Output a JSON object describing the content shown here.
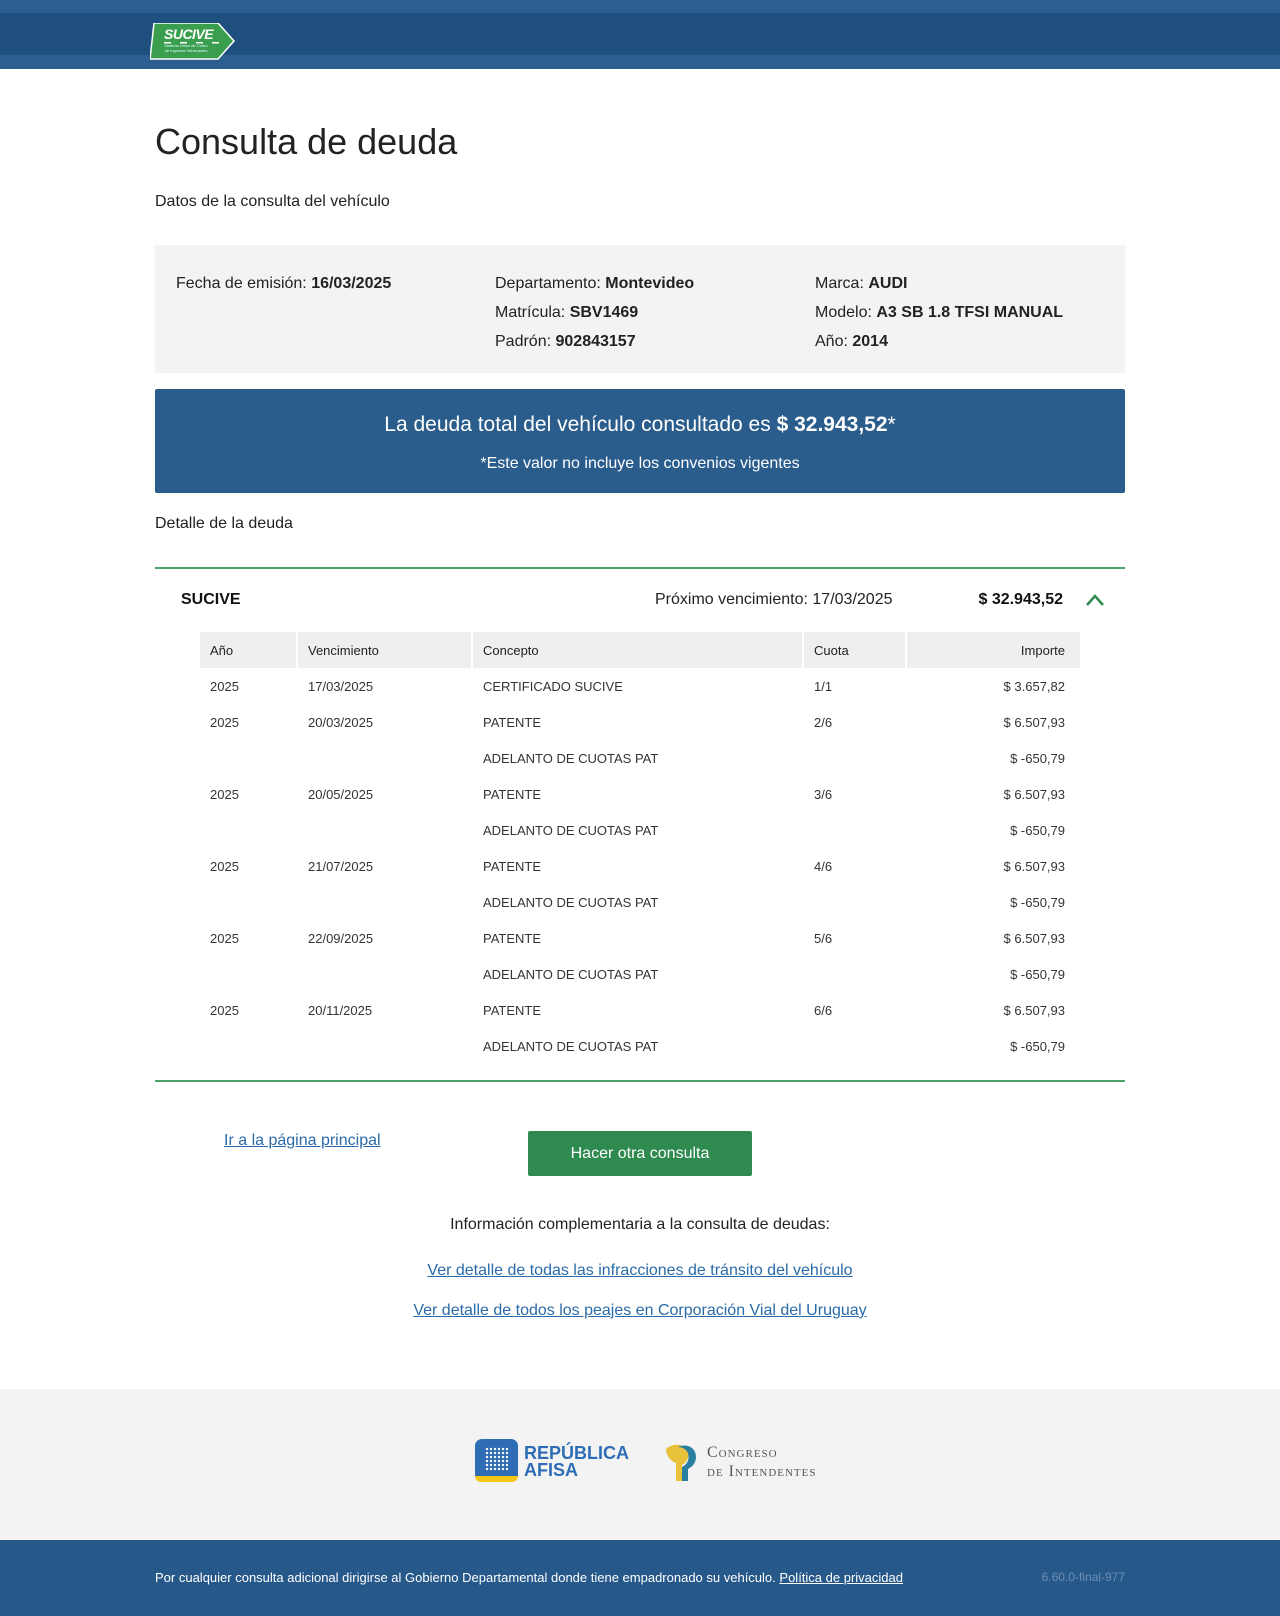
{
  "header": {
    "logo_text": "SUCIVE",
    "logo_subtext": "Sistema Único de Cobro de Ingresos Vehiculares"
  },
  "page": {
    "title": "Consulta de deuda",
    "subtitle": "Datos de la consulta del vehículo"
  },
  "vehicle": {
    "fecha_label": "Fecha de emisión:",
    "fecha_value": "16/03/2025",
    "departamento_label": "Departamento:",
    "departamento_value": "Montevideo",
    "matricula_label": "Matrícula:",
    "matricula_value": "SBV1469",
    "padron_label": "Padrón:",
    "padron_value": "902843157",
    "marca_label": "Marca:",
    "marca_value": "AUDI",
    "modelo_label": "Modelo:",
    "modelo_value": "A3 SB 1.8 TFSI MANUAL",
    "anio_label": "Año:",
    "anio_value": "2014"
  },
  "total": {
    "text": "La deuda total del vehículo consultado es",
    "amount": "$ 32.943,52",
    "asterisk": "*",
    "note": "*Este valor no incluye los convenios vigentes"
  },
  "detail": {
    "title": "Detalle de la deuda",
    "panel_name": "SUCIVE",
    "next_due_label": "Próximo vencimiento:",
    "next_due_value": "17/03/2025",
    "panel_amount": "$ 32.943,52",
    "columns": [
      "Año",
      "Vencimiento",
      "Concepto",
      "Cuota",
      "Importe"
    ],
    "rows": [
      [
        "2025",
        "17/03/2025",
        "CERTIFICADO SUCIVE",
        "1/1",
        "$ 3.657,82"
      ],
      [
        "2025",
        "20/03/2025",
        "PATENTE",
        "2/6",
        "$ 6.507,93"
      ],
      [
        "",
        "",
        "ADELANTO DE CUOTAS PAT",
        "",
        "$ -650,79"
      ],
      [
        "2025",
        "20/05/2025",
        "PATENTE",
        "3/6",
        "$ 6.507,93"
      ],
      [
        "",
        "",
        "ADELANTO DE CUOTAS PAT",
        "",
        "$ -650,79"
      ],
      [
        "2025",
        "21/07/2025",
        "PATENTE",
        "4/6",
        "$ 6.507,93"
      ],
      [
        "",
        "",
        "ADELANTO DE CUOTAS PAT",
        "",
        "$ -650,79"
      ],
      [
        "2025",
        "22/09/2025",
        "PATENTE",
        "5/6",
        "$ 6.507,93"
      ],
      [
        "",
        "",
        "ADELANTO DE CUOTAS PAT",
        "",
        "$ -650,79"
      ],
      [
        "2025",
        "20/11/2025",
        "PATENTE",
        "6/6",
        "$ 6.507,93"
      ],
      [
        "",
        "",
        "ADELANTO DE CUOTAS PAT",
        "",
        "$ -650,79"
      ]
    ]
  },
  "actions": {
    "home_link": "Ir a la página principal",
    "new_query_button": "Hacer otra consulta"
  },
  "complementary": {
    "title": "Información complementaria a la consulta de deudas:",
    "link_infracciones": "Ver detalle de todas las infracciones de tránsito del vehículo",
    "link_peajes": "Ver detalle de todos los peajes en Corporación Vial del Uruguay"
  },
  "logos": {
    "republica_line1": "REPÚBLICA",
    "republica_line2": "AFISA",
    "congreso_line1": "Congreso",
    "congreso_line2": "de Intendentes"
  },
  "footer": {
    "text": "Por cualquier consulta adicional dirigirse al Gobierno Departamental donde tiene empadronado su vehículo.",
    "privacy_link": "Política de privacidad",
    "version": "6.60.0-final-977"
  },
  "colors": {
    "header_blue": "#1f4f7f",
    "banner_blue": "#2a5c8c",
    "accent_green": "#2f8a4f",
    "link_blue": "#2a6aa8"
  }
}
